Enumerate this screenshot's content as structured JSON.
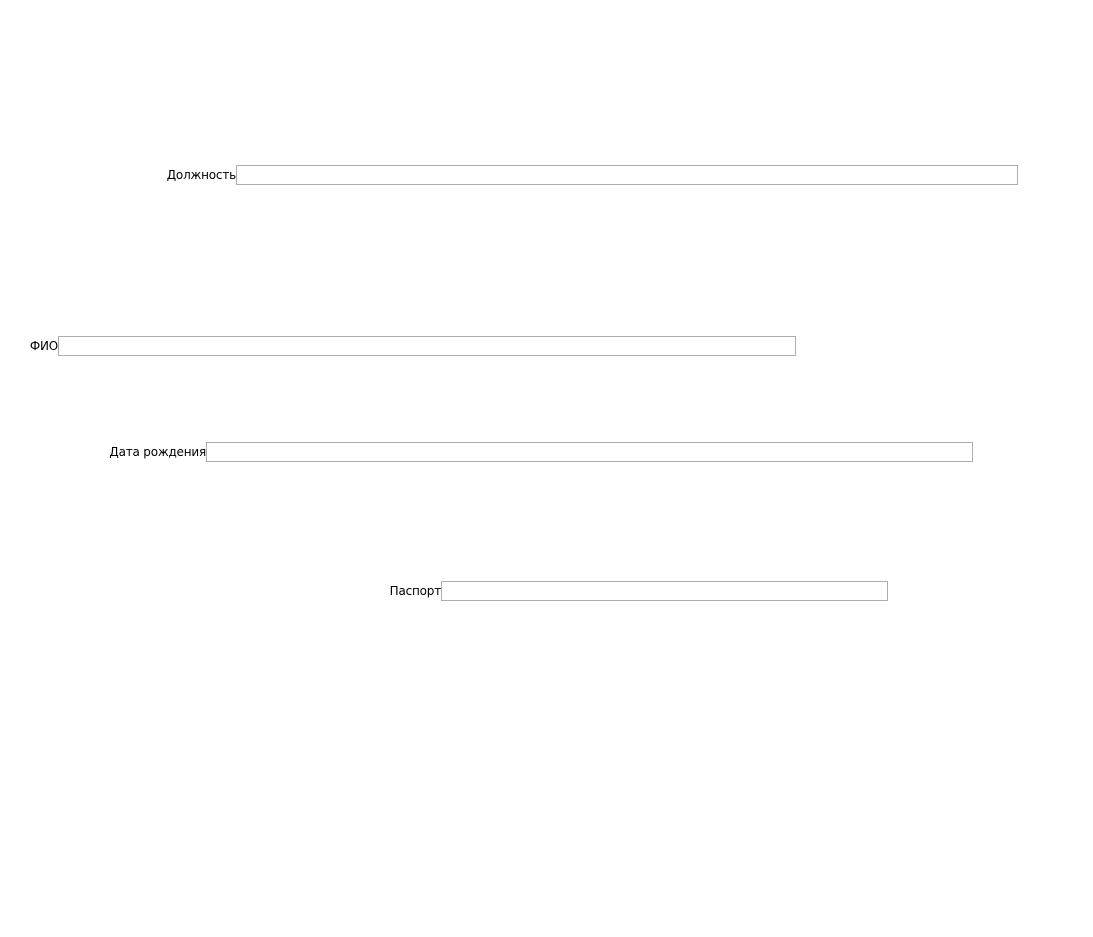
{
  "form": {
    "position": {
      "label": "Должность",
      "value": "",
      "placeholder": ""
    },
    "fullname": {
      "label": "ФИО",
      "value": "",
      "placeholder": ""
    },
    "birthdate": {
      "label": "Дата рождения",
      "value": "",
      "placeholder": ""
    },
    "passport": {
      "label": "Паспорт",
      "value": "",
      "placeholder": ""
    }
  }
}
